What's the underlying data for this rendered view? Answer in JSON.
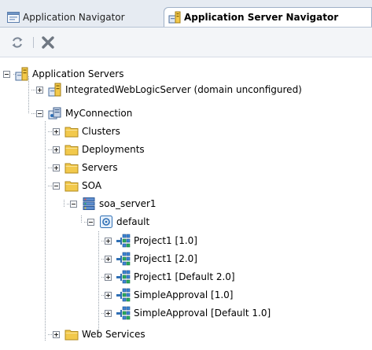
{
  "tabs": [
    {
      "label": "Application Navigator",
      "active": false
    },
    {
      "label": "Application Server Navigator",
      "active": true
    }
  ],
  "toolbar": {
    "refresh_icon": "refresh-icon",
    "delete_icon": "delete-x-icon"
  },
  "tree": [
    {
      "label": "Application Servers",
      "icon": "server-stack-icon",
      "expanded": true,
      "depth": 0
    },
    {
      "label": "IntegratedWebLogicServer (domain unconfigured)",
      "icon": "server-stack-icon",
      "expanded": false,
      "depth": 1
    },
    {
      "label": "MyConnection",
      "icon": "connection-icon",
      "expanded": true,
      "depth": 1
    },
    {
      "label": "Clusters",
      "icon": "folder-icon",
      "expanded": false,
      "depth": 2
    },
    {
      "label": "Deployments",
      "icon": "folder-icon",
      "expanded": false,
      "depth": 2
    },
    {
      "label": "Servers",
      "icon": "folder-icon",
      "expanded": false,
      "depth": 2
    },
    {
      "label": "SOA",
      "icon": "folder-icon",
      "expanded": true,
      "depth": 2
    },
    {
      "label": "soa_server1",
      "icon": "soa-server-icon",
      "expanded": true,
      "depth": 3
    },
    {
      "label": "default",
      "icon": "partition-icon",
      "expanded": true,
      "depth": 4
    },
    {
      "label": "Project1 [1.0]",
      "icon": "composite-icon",
      "expanded": false,
      "depth": 5
    },
    {
      "label": "Project1 [2.0]",
      "icon": "composite-icon",
      "expanded": false,
      "depth": 5
    },
    {
      "label": "Project1 [Default 2.0]",
      "icon": "composite-icon",
      "expanded": false,
      "depth": 5
    },
    {
      "label": "SimpleApproval [1.0]",
      "icon": "composite-icon",
      "expanded": false,
      "depth": 5
    },
    {
      "label": "SimpleApproval [Default 1.0]",
      "icon": "composite-icon",
      "expanded": false,
      "depth": 5
    },
    {
      "label": "Web Services",
      "icon": "folder-icon",
      "expanded": false,
      "depth": 2
    }
  ],
  "colors": {
    "folder": "#f2c94c",
    "accent": "#2f6fb5",
    "delete": "#6f7782"
  }
}
